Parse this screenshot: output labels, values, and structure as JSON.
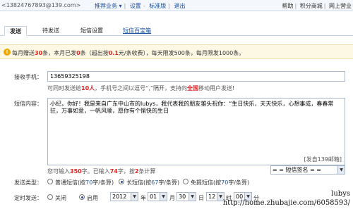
{
  "topbar": {
    "user": "<13824767893@139.com>",
    "nav": [
      "推荐业务 ▾",
      "设置",
      "标准版",
      "退出"
    ],
    "right": [
      "帮助",
      "积分商城",
      "网上营业"
    ]
  },
  "tabs": [
    "发送",
    "待发送",
    "短信设置",
    "短信百宝箱"
  ],
  "info": {
    "prefix": "每月赠送",
    "free": "30",
    "mid1": "条，本月已发",
    "sent": "0",
    "mid2": "条（超出按",
    "price": "0.1",
    "mid3": "元/条收费），每天限发500条，每月限发1000条。"
  },
  "receiver": {
    "label": "接收手机：",
    "value": "13659325198",
    "hint_pre": "可同时发送给",
    "hint_num": "10人",
    "hint_mid": "，手机号之间以逗号“,”隔开，支持向",
    "hint_net": "全国",
    "hint_post": "移动用户发送!"
  },
  "content": {
    "label": "短信内容：",
    "text": "小纪，你好！我是来自广东中山市的lubys，我代表我的朋友雏头祝你：“生日快乐，天天快乐，心想事成，春春常驻，万事如意，一帆风顺，愿你有个愉快的生日",
    "signature": "[发自139邮箱]"
  },
  "counter": {
    "pre": "您可输入",
    "max": "350",
    "mid": "字。已输入",
    "typed": "74",
    "mid2": "字，按",
    "count": "2",
    "post": "条计算"
  },
  "signature_select": "= = 短信签名 = =",
  "send_type": {
    "label": "发送类型：",
    "options": [
      {
        "pre": "普通短信(按",
        "num": "70",
        "post": "字/条算)"
      },
      {
        "pre": "长短信(按",
        "num": "67",
        "post": "字/条算)"
      },
      {
        "pre": "免提短信(按",
        "num": "70",
        "post": "字/条算)"
      }
    ],
    "selected": 1
  },
  "timer": {
    "label": "定时发送：",
    "off": "关闭",
    "on": "启用",
    "year": "2012",
    "year_unit": "年",
    "month": "01",
    "month_unit": "月",
    "day": "30",
    "day_unit": "日",
    "hour": "12",
    "hour_unit": "时",
    "minute": "00",
    "minute_unit": "分"
  },
  "watermark": {
    "line1": "lubys",
    "line2": "http://home.zhubajie.com/6058593/"
  }
}
